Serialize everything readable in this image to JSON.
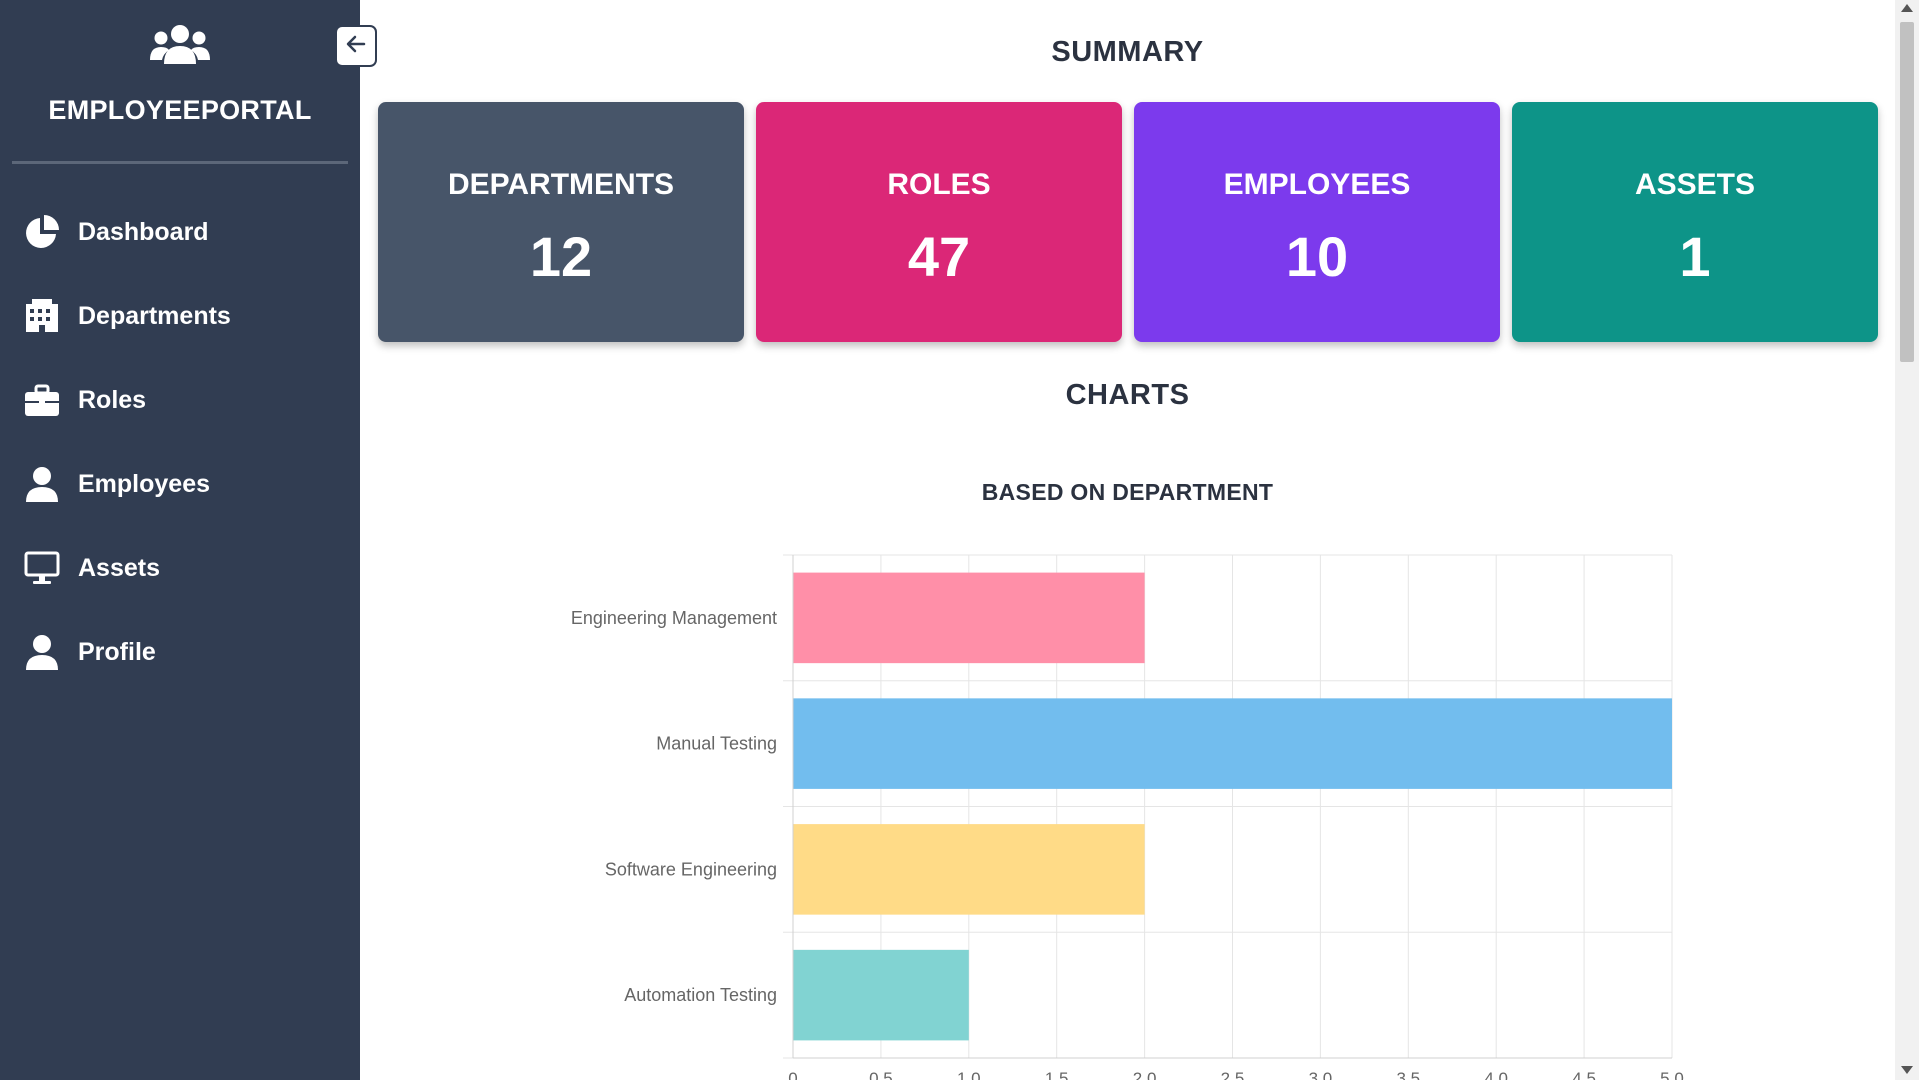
{
  "sidebar": {
    "brand_title": "EMPLOYEEPORTAL",
    "brand_icon": "users-icon",
    "collapse_icon": "arrow-left-icon",
    "items": [
      {
        "label": "Dashboard",
        "icon": "chart-pie-icon"
      },
      {
        "label": "Departments",
        "icon": "building-icon"
      },
      {
        "label": "Roles",
        "icon": "briefcase-icon"
      },
      {
        "label": "Employees",
        "icon": "user-icon"
      },
      {
        "label": "Assets",
        "icon": "desktop-icon"
      },
      {
        "label": "Profile",
        "icon": "user-icon"
      }
    ]
  },
  "main": {
    "summary_title": "SUMMARY",
    "charts_title": "CHARTS",
    "cards": [
      {
        "label": "DEPARTMENTS",
        "value": "12",
        "color": "#475569"
      },
      {
        "label": "ROLES",
        "value": "47",
        "color": "#db2777"
      },
      {
        "label": "EMPLOYEES",
        "value": "10",
        "color": "#7c3aed"
      },
      {
        "label": "ASSETS",
        "value": "1",
        "color": "#0d9488"
      }
    ]
  },
  "colors": {
    "sidebar_bg": "#313d52",
    "bar_colors": [
      "#ff8fa8",
      "#72bdee",
      "#ffdb87",
      "#81d3d2"
    ]
  },
  "chart_data": {
    "type": "bar",
    "orientation": "horizontal",
    "title": "BASED ON DEPARTMENT",
    "categories": [
      "Engineering Management",
      "Manual Testing",
      "Software Engineering",
      "Automation Testing"
    ],
    "values": [
      2,
      5,
      2,
      1
    ],
    "xlim": [
      0,
      5
    ],
    "x_ticks": [
      0,
      0.5,
      1.0,
      1.5,
      2.0,
      2.5,
      3.0,
      3.5,
      4.0,
      4.5,
      5.0
    ],
    "grid": true,
    "legend": "none"
  }
}
